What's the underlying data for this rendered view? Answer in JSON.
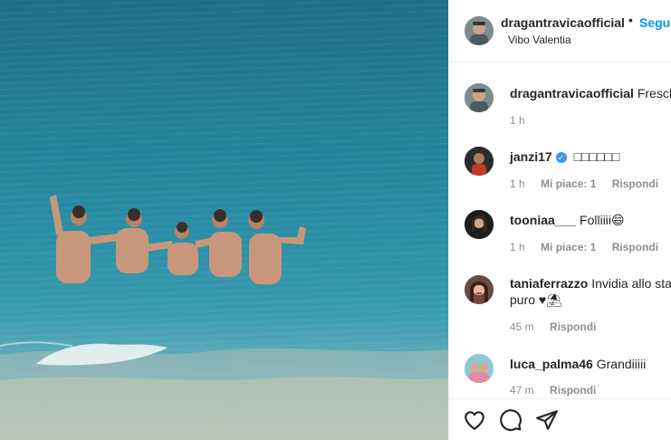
{
  "header": {
    "username": "dragantravicaofficial",
    "dot": "•",
    "follow_label": "Segui",
    "location": "Vibo Valentia"
  },
  "comments": [
    {
      "user": "dragantravicaofficial",
      "text": "Freschin",
      "time": "1 h"
    },
    {
      "user": "janzi17",
      "text": "□□□□□□",
      "time": "1 h",
      "likes": "Mi piace: 1",
      "reply": "Rispondi",
      "verified": true
    },
    {
      "user": "tooniaa___",
      "text": "Folliiii😄",
      "time": "1 h",
      "likes": "Mi piace: 1",
      "reply": "Rispondi"
    },
    {
      "user": "taniaferrazzo",
      "text": "Invidia allo stat",
      "text2": "puro ♥⛱",
      "time": "45 m",
      "reply": "Rispondi"
    },
    {
      "user": "luca_palma46",
      "text": "Grandiiiii",
      "time": "47 m",
      "reply": "Rispondi"
    }
  ],
  "icons": {
    "like": "heart-icon",
    "comment": "comment-bubble-icon",
    "share": "paper-plane-icon"
  },
  "colors": {
    "follow": "#0095f6",
    "verified": "#3897f0",
    "meta": "#8e8e8e"
  }
}
